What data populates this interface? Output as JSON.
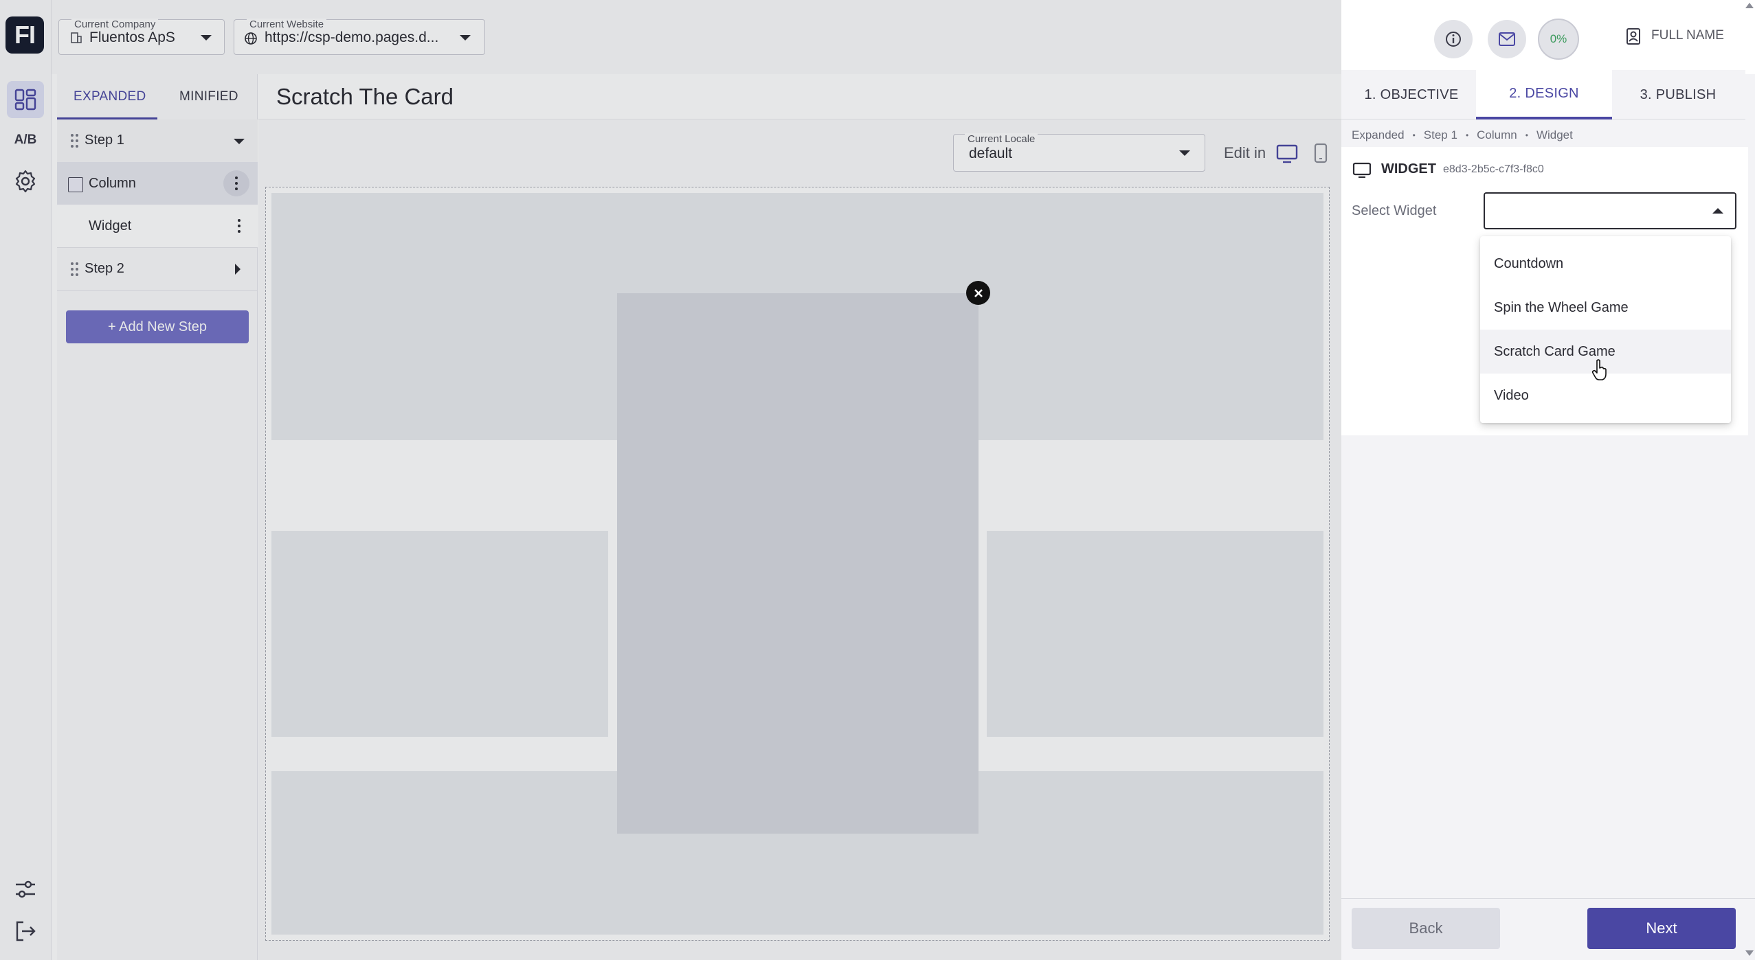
{
  "app": {
    "logo_text": "FI"
  },
  "rail": {
    "ab_label": "A/B"
  },
  "topbar": {
    "company": {
      "label": "Current Company",
      "value": "Fluentos ApS"
    },
    "website": {
      "label": "Current Website",
      "value": "https://csp-demo.pages.d..."
    },
    "progress": "0%",
    "user_name": "FULL NAME"
  },
  "steps_panel": {
    "tabs": [
      {
        "label": "EXPANDED",
        "active": true
      },
      {
        "label": "MINIFIED",
        "active": false
      }
    ],
    "items": [
      {
        "label": "Step 1"
      },
      {
        "label": "Column"
      },
      {
        "label": "Widget"
      },
      {
        "label": "Step 2"
      }
    ],
    "add_step": "+ Add New Step"
  },
  "editor": {
    "title": "Scratch The Card",
    "locale": {
      "label": "Current Locale",
      "value": "default"
    },
    "edit_in": "Edit in"
  },
  "wizard": {
    "tabs": [
      {
        "label": "1. OBJECTIVE"
      },
      {
        "label": "2. DESIGN",
        "active": true
      },
      {
        "label": "3. PUBLISH"
      }
    ],
    "breadcrumb": [
      "Expanded",
      "Step 1",
      "Column",
      "Widget"
    ],
    "widget_heading": "WIDGET",
    "widget_id": "e8d3-2b5c-c7f3-f8c0",
    "select_label": "Select Widget",
    "select_value": "",
    "options": [
      "Countdown",
      "Spin the Wheel Game",
      "Scratch Card Game",
      "Video"
    ],
    "hovered_option": "Scratch Card Game",
    "back": "Back",
    "next": "Next"
  },
  "colors": {
    "accent": "#4a47a3",
    "accent_light": "#7371c6",
    "active_rail": "#dfe1f5"
  }
}
